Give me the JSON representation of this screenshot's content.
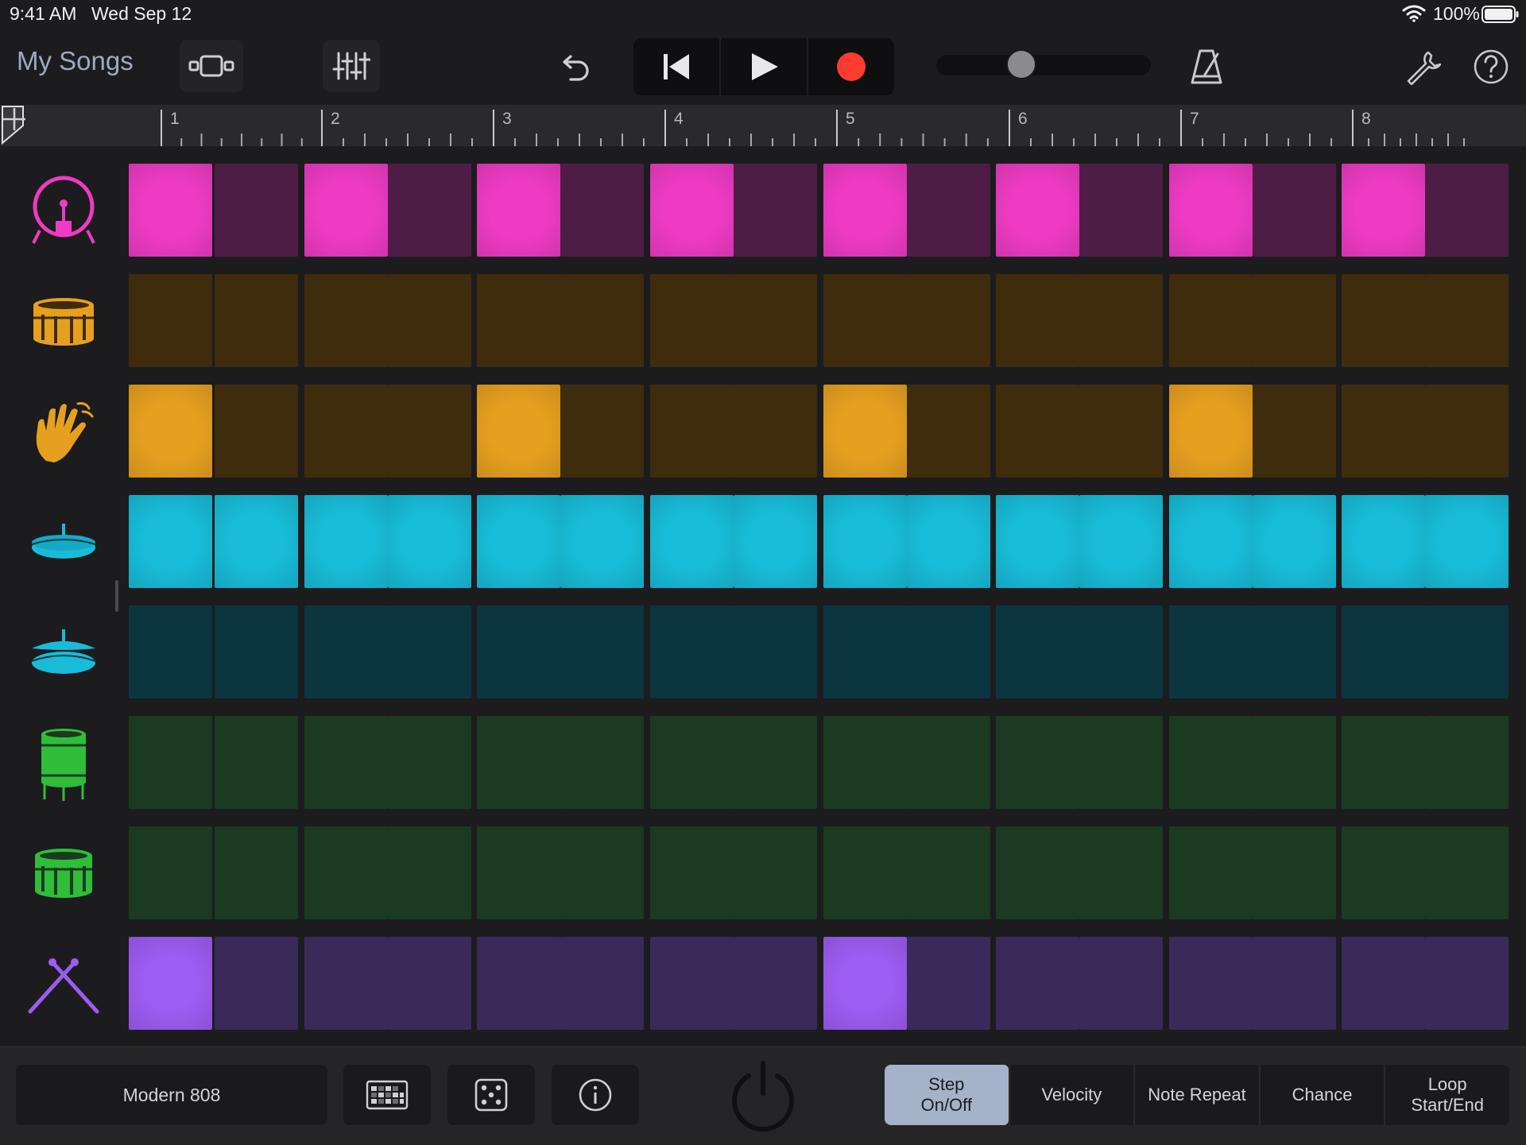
{
  "status": {
    "time": "9:41 AM",
    "date": "Wed Sep 12",
    "battery": "100%"
  },
  "toolbar": {
    "my_songs": "My Songs",
    "volume_level": 0.38
  },
  "ruler": {
    "bars": [
      "1",
      "2",
      "3",
      "4",
      "5",
      "6",
      "7",
      "8"
    ]
  },
  "tracks": [
    {
      "name": "kick",
      "icon": "kick-drum-icon",
      "on": "#ee3bc4",
      "off": "#4d1d46",
      "steps": [
        1,
        0,
        1,
        0,
        1,
        0,
        1,
        0,
        1,
        0,
        1,
        0,
        1,
        0,
        1,
        0
      ]
    },
    {
      "name": "snare",
      "icon": "snare-drum-icon",
      "on": "#e6a020",
      "off": "#3f2c0d",
      "steps": [
        0,
        0,
        0,
        0,
        0,
        0,
        0,
        0,
        0,
        0,
        0,
        0,
        0,
        0,
        0,
        0
      ]
    },
    {
      "name": "clap",
      "icon": "clap-hand-icon",
      "on": "#e6a020",
      "off": "#3f2c0d",
      "steps": [
        1,
        0,
        0,
        0,
        1,
        0,
        0,
        0,
        1,
        0,
        0,
        0,
        1,
        0,
        0,
        0
      ]
    },
    {
      "name": "closed-hihat",
      "icon": "closed-hihat-icon",
      "on": "#18bcd8",
      "off": "#0b3640",
      "steps": [
        1,
        1,
        1,
        1,
        1,
        1,
        1,
        1,
        1,
        1,
        1,
        1,
        1,
        1,
        1,
        1
      ]
    },
    {
      "name": "open-hihat",
      "icon": "open-hihat-icon",
      "on": "#18bcd8",
      "off": "#0b3640",
      "steps": [
        0,
        0,
        0,
        0,
        0,
        0,
        0,
        0,
        0,
        0,
        0,
        0,
        0,
        0,
        0,
        0
      ]
    },
    {
      "name": "tom-high",
      "icon": "floor-tom-icon",
      "on": "#2fbd3a",
      "off": "#1a3a21",
      "steps": [
        0,
        0,
        0,
        0,
        0,
        0,
        0,
        0,
        0,
        0,
        0,
        0,
        0,
        0,
        0,
        0
      ]
    },
    {
      "name": "tom-low",
      "icon": "tom-drum-icon",
      "on": "#2fbd3a",
      "off": "#1a3a21",
      "steps": [
        0,
        0,
        0,
        0,
        0,
        0,
        0,
        0,
        0,
        0,
        0,
        0,
        0,
        0,
        0,
        0
      ]
    },
    {
      "name": "sticks",
      "icon": "drumsticks-icon",
      "on": "#9d5cf2",
      "off": "#3a2a5a",
      "steps": [
        1,
        0,
        0,
        0,
        0,
        0,
        0,
        0,
        1,
        0,
        0,
        0,
        0,
        0,
        0,
        0
      ]
    }
  ],
  "bottom": {
    "kit_name": "Modern 808",
    "modes": [
      "Step\nOn/Off",
      "Velocity",
      "Note Repeat",
      "Chance",
      "Loop\nStart/End"
    ],
    "active_mode": 0
  }
}
